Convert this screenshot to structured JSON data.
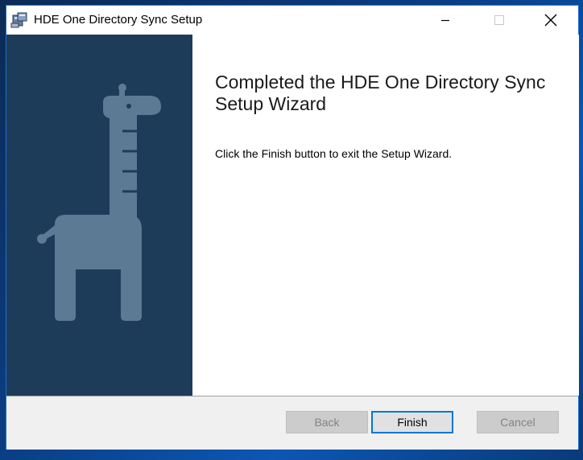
{
  "window": {
    "title": "HDE One Directory Sync Setup"
  },
  "icons": {
    "app": "installer-icon",
    "minimize": "minimize-icon",
    "maximize": "maximize-icon",
    "close": "close-icon",
    "illustration": "giraffe-illustration"
  },
  "colors": {
    "side_panel": "#1d3c5a",
    "giraffe": "#5c7a94",
    "focus_border": "#0078d7"
  },
  "content": {
    "heading": "Completed the HDE One Directory Sync Setup Wizard",
    "body": "Click the Finish button to exit the Setup Wizard."
  },
  "buttons": {
    "back": "Back",
    "finish": "Finish",
    "cancel": "Cancel"
  }
}
